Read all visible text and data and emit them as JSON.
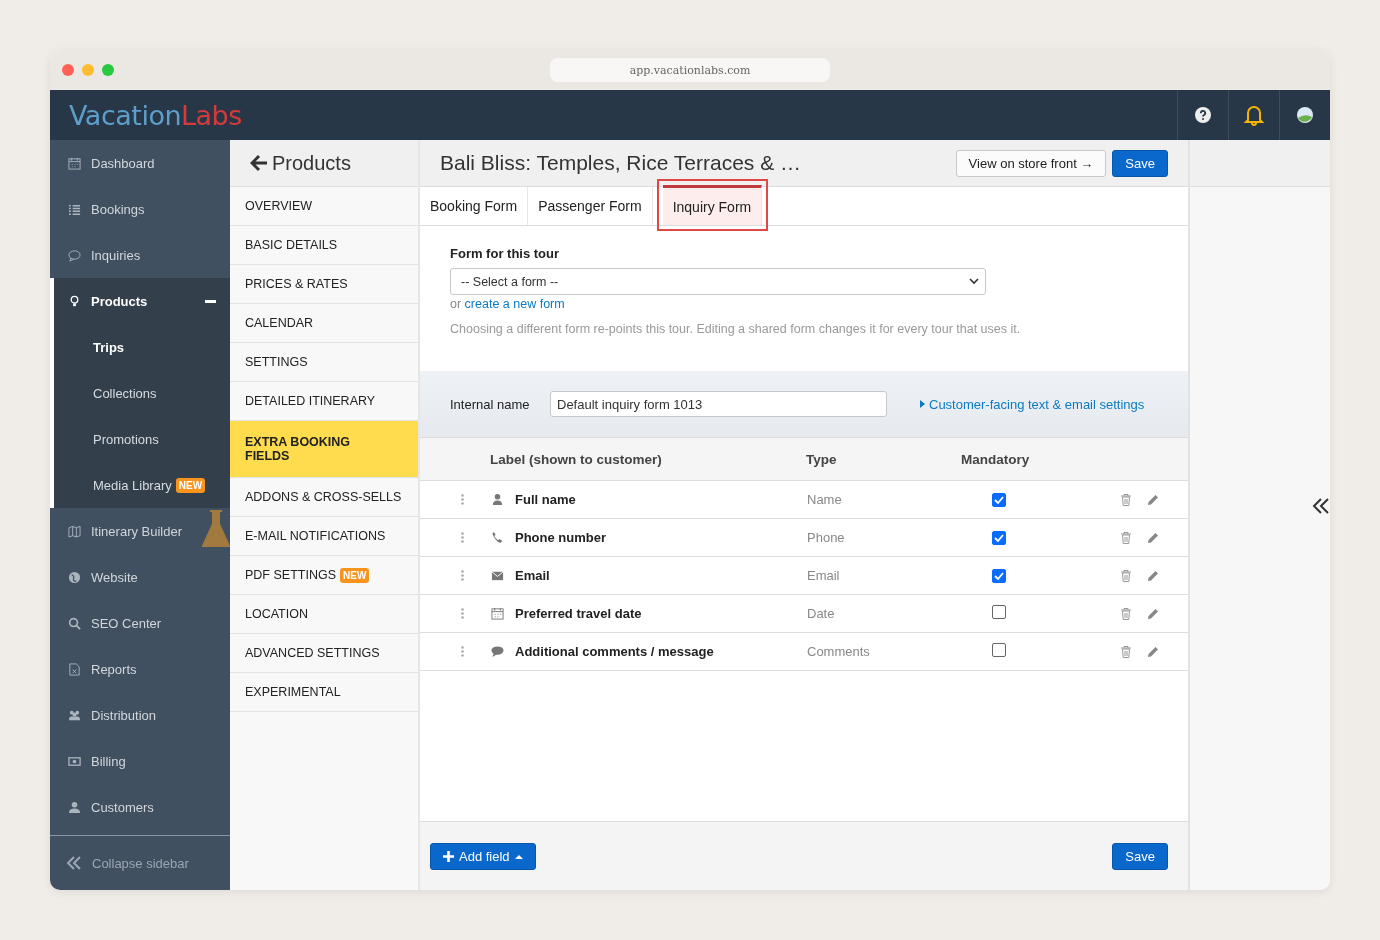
{
  "browser": {
    "url": "app.vacationlabs.com"
  },
  "header": {
    "logo_part_1": "Vacation",
    "logo_part_2": "Labs"
  },
  "sidebar": {
    "items": [
      {
        "label": "Dashboard",
        "selected": false
      },
      {
        "label": "Bookings",
        "selected": false
      },
      {
        "label": "Inquiries",
        "selected": false
      },
      {
        "label": "Products",
        "selected": true,
        "expanded": true,
        "children": [
          {
            "label": "Trips",
            "selected": true
          },
          {
            "label": "Collections",
            "selected": false
          },
          {
            "label": "Promotions",
            "selected": false
          },
          {
            "label": "Media Library",
            "selected": false,
            "badge": "NEW"
          }
        ]
      },
      {
        "label": "Itinerary Builder",
        "selected": false
      },
      {
        "label": "Website",
        "selected": false
      },
      {
        "label": "SEO Center",
        "selected": false
      },
      {
        "label": "Reports",
        "selected": false
      },
      {
        "label": "Distribution",
        "selected": false
      },
      {
        "label": "Billing",
        "selected": false
      },
      {
        "label": "Customers",
        "selected": false
      }
    ],
    "collapse": "Collapse sidebar"
  },
  "subnav": {
    "title": "Products",
    "items": [
      {
        "label": "OVERVIEW",
        "selected": false
      },
      {
        "label": "BASIC DETAILS",
        "selected": false
      },
      {
        "label": "PRICES & RATES",
        "selected": false
      },
      {
        "label": "CALENDAR",
        "selected": false
      },
      {
        "label": "SETTINGS",
        "selected": false
      },
      {
        "label": "DETAILED ITINERARY",
        "selected": false
      },
      {
        "label": "EXTRA BOOKING FIELDS",
        "selected": true
      },
      {
        "label": "ADDONS & CROSS-SELLS",
        "selected": false
      },
      {
        "label": "E-MAIL NOTIFICATIONS",
        "selected": false
      },
      {
        "label": "PDF SETTINGS",
        "selected": false,
        "badge": "NEW"
      },
      {
        "label": "LOCATION",
        "selected": false
      },
      {
        "label": "ADVANCED SETTINGS",
        "selected": false
      },
      {
        "label": "EXPERIMENTAL",
        "selected": false
      }
    ]
  },
  "main": {
    "title": "Bali Bliss: Temples, Rice Terraces & …",
    "view_button": "View on store front →",
    "save_button": "Save",
    "tabs": [
      {
        "label": "Booking Form",
        "selected": false
      },
      {
        "label": "Passenger Form",
        "selected": false
      },
      {
        "label": "Inquiry Form",
        "selected": true
      }
    ],
    "form_label": "Form for this tour",
    "form_select": "-- Select a form --",
    "or_text": "or",
    "create_link": "create a new form",
    "help_text": "Choosing a different form re-points this tour. Editing a shared form changes it for every tour that uses it.",
    "internal_name_label": "Internal name",
    "internal_name_value": "Default inquiry form 1013",
    "settings_link": "Customer-facing text & email settings",
    "table": {
      "columns": [
        "Label (shown to customer)",
        "Type",
        "Mandatory"
      ],
      "rows": [
        {
          "label": "Full name",
          "type": "Name",
          "checked": true
        },
        {
          "label": "Phone number",
          "type": "Phone",
          "checked": true
        },
        {
          "label": "Email",
          "type": "Email",
          "checked": true
        },
        {
          "label": "Preferred travel date",
          "type": "Date",
          "checked": false
        },
        {
          "label": "Additional comments / message",
          "type": "Comments",
          "checked": false
        }
      ]
    },
    "add_button": "Add field",
    "footer_save": "Save"
  }
}
